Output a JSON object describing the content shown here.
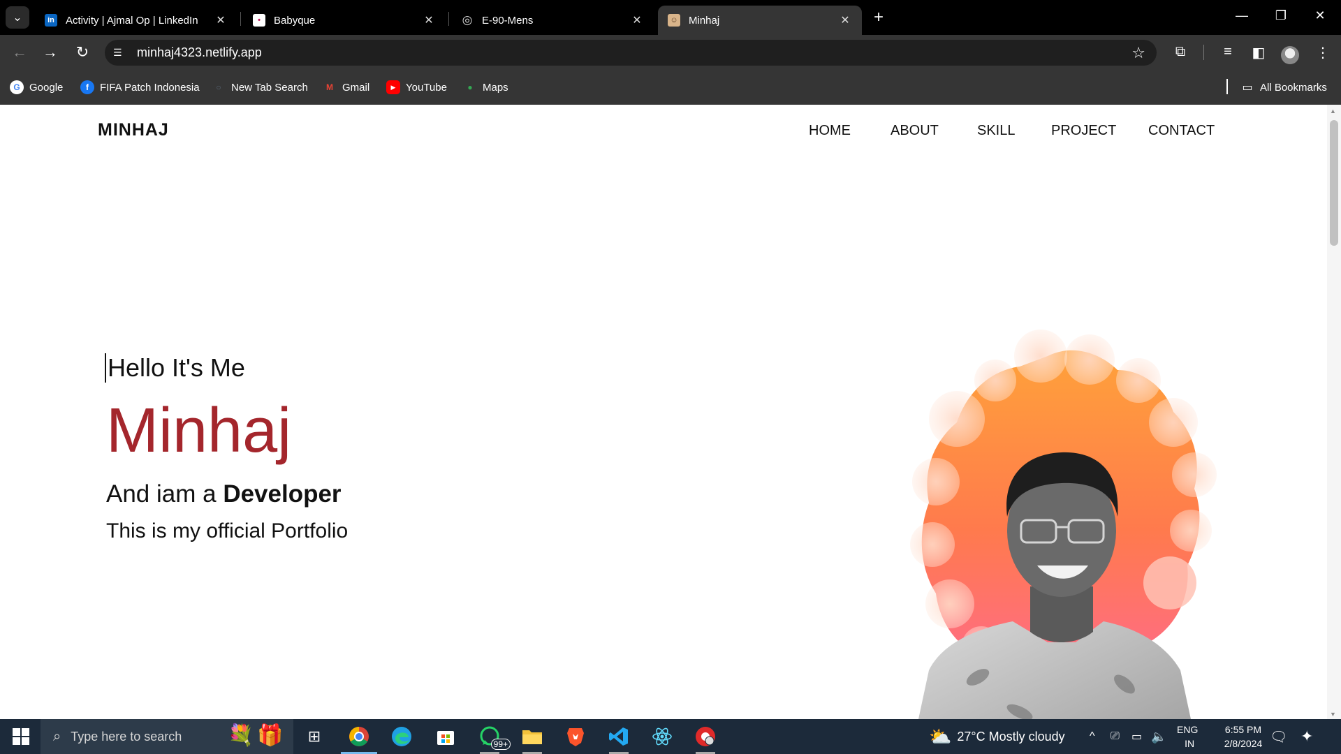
{
  "browser": {
    "tabs": [
      {
        "title": "Activity | Ajmal Op | LinkedIn",
        "favicon": "linkedin-icon",
        "favicon_text": "in",
        "favicon_color": "#0a66c2"
      },
      {
        "title": "Babyque",
        "favicon": "babyque-icon",
        "favicon_text": "•",
        "favicon_color": "#ffffff"
      },
      {
        "title": "E-90-Mens",
        "favicon": "globe-icon",
        "favicon_text": "◎",
        "favicon_color": "#353535"
      },
      {
        "title": "Minhaj",
        "favicon": "portrait-icon",
        "favicon_text": "☺",
        "favicon_color": "#d9b48a"
      }
    ],
    "active_tab": 3,
    "tab_close_glyph": "✕",
    "new_tab_glyph": "+",
    "url": "minhaj4323.netlify.app",
    "bookmarks": [
      {
        "label": "Google",
        "icon": "google-icon",
        "glyph": "G",
        "color": "#ffffff",
        "fg": "#4285f4"
      },
      {
        "label": "FIFA Patch Indonesia",
        "icon": "facebook-icon",
        "glyph": "f",
        "color": "#1877f2",
        "fg": "#ffffff"
      },
      {
        "label": "New Tab Search",
        "icon": "new-tab-search-icon",
        "glyph": "○",
        "color": "#353535",
        "fg": "#5b6a7a"
      },
      {
        "label": "Gmail",
        "icon": "gmail-icon",
        "glyph": "M",
        "color": "#353535",
        "fg": "#ea4335"
      },
      {
        "label": "YouTube",
        "icon": "youtube-icon",
        "glyph": "▶",
        "color": "#ff0000",
        "fg": "#ffffff"
      },
      {
        "label": "Maps",
        "icon": "maps-icon",
        "glyph": "●",
        "color": "#353535",
        "fg": "#34a853"
      }
    ],
    "all_bookmarks_label": "All Bookmarks"
  },
  "page": {
    "brand": "MINHAJ",
    "nav": [
      "HOME",
      "ABOUT",
      "SKILL",
      "PROJECT",
      "CONTACT"
    ],
    "hero": {
      "greeting": "Hello It's Me",
      "name": "Minhaj",
      "role_prefix": "And iam a ",
      "role": "Developer",
      "tagline": "This is my official Portfolio"
    },
    "colors": {
      "name": "#a4262c",
      "splash_top": "#ffa23a",
      "splash_bottom": "#ff6f6a"
    }
  },
  "taskbar": {
    "search_placeholder": "Type here to search",
    "whatsapp_badge": "99+",
    "weather": "27°C  Mostly cloudy",
    "lang_top": "ENG",
    "lang_bottom": "IN",
    "time": "6:55 PM",
    "date": "2/8/2024"
  }
}
